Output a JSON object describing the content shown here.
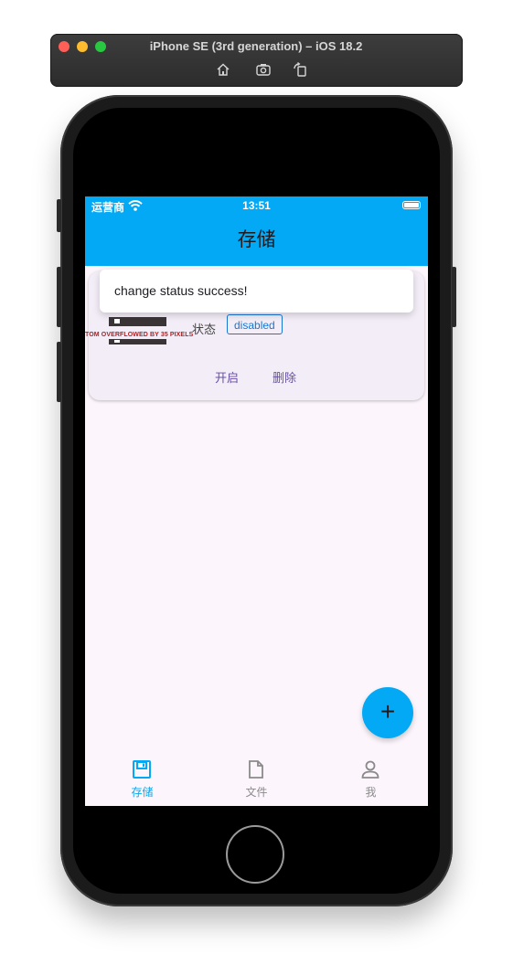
{
  "simulator": {
    "title": "iPhone SE (3rd generation) – iOS 18.2",
    "tools": [
      "home-icon",
      "screenshot-icon",
      "rotate-icon"
    ]
  },
  "statusbar": {
    "carrier": "运营商",
    "time": "13:51"
  },
  "appbar": {
    "title": "存储"
  },
  "card": {
    "overflow_warning": "TOM OVERFLOWED BY 35 PIXELS",
    "status_label": "状态",
    "status_value": "disabled",
    "actions": {
      "enable": "开启",
      "delete": "删除"
    }
  },
  "snackbar": {
    "message": "change status success!"
  },
  "fab": {
    "label": "+"
  },
  "bottom_nav": {
    "items": [
      {
        "label": "存储",
        "icon": "save-icon",
        "active": true
      },
      {
        "label": "文件",
        "icon": "file-icon",
        "active": false
      },
      {
        "label": "我",
        "icon": "person-icon",
        "active": false
      }
    ]
  },
  "colors": {
    "primary": "#03a9f4",
    "background": "#fcf6fc",
    "card": "#f3edf7",
    "action_text": "#6750a4",
    "chip_border": "#1976d2",
    "inactive_nav": "#8a8a8a"
  }
}
